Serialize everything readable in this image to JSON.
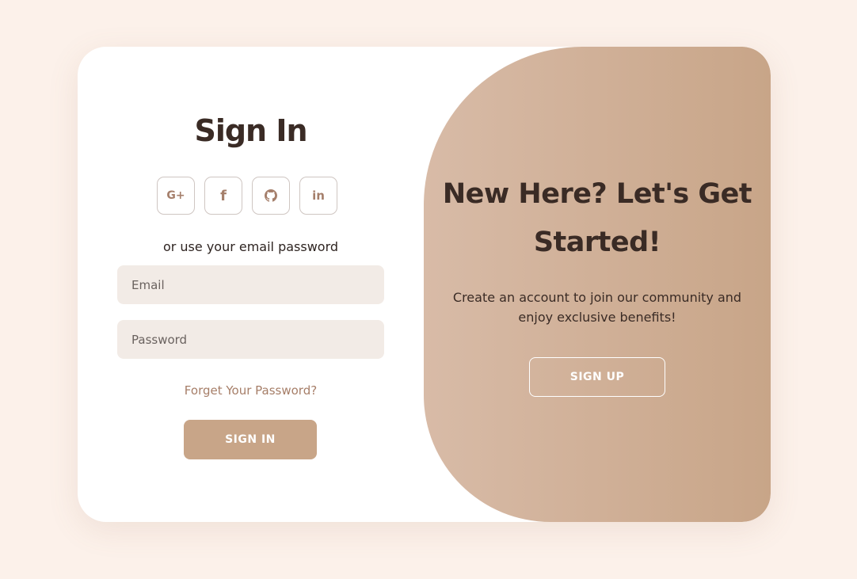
{
  "colors": {
    "page_background": "#fcf1ea",
    "card_background": "#ffffff",
    "accent": "#c8a588",
    "gradient_start": "#d8bba7",
    "gradient_end": "#c8a588",
    "input_background": "#f2ebe6",
    "text_dark": "#3a2b25",
    "link": "#a67e68"
  },
  "signin": {
    "title": "Sign In",
    "socials": [
      {
        "icon": "google-plus-icon",
        "label": "G+"
      },
      {
        "icon": "facebook-icon",
        "label": "f"
      },
      {
        "icon": "github-icon",
        "label": ""
      },
      {
        "icon": "linkedin-icon",
        "label": "in"
      }
    ],
    "subtext": "or use your email password",
    "email_placeholder": "Email",
    "password_placeholder": "Password",
    "forgot": "Forget Your Password?",
    "button": "SIGN IN"
  },
  "signup_panel": {
    "title": "New Here? Let's Get Started!",
    "description": "Create an account to join our community and enjoy exclusive benefits!",
    "button": "SIGN UP"
  }
}
